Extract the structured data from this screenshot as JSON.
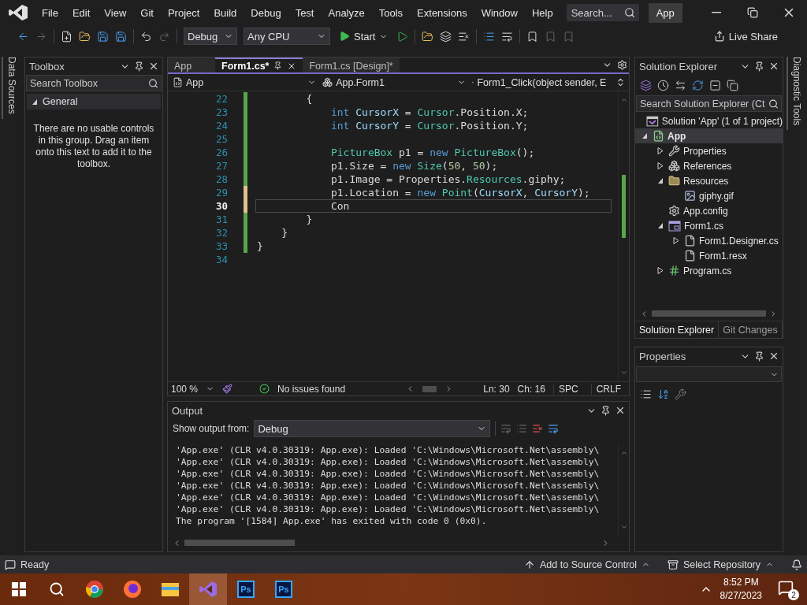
{
  "menu_bar": {
    "items": [
      "File",
      "Edit",
      "View",
      "Git",
      "Project",
      "Build",
      "Debug",
      "Test",
      "Analyze",
      "Tools",
      "Extensions",
      "Window",
      "Help"
    ],
    "search": {
      "placeholder": "Search..."
    },
    "solution_name": "App"
  },
  "toolbar": {
    "configuration": "Debug",
    "platform": "Any CPU",
    "start": "Start",
    "live_share": "Live Share"
  },
  "left_strip": {
    "label": "Data Sources"
  },
  "toolbox": {
    "title": "Toolbox",
    "search": {
      "placeholder": "Search Toolbox"
    },
    "group": {
      "label": "General",
      "expanded": true
    },
    "message": "There are no usable controls in this group. Drag an item onto this text to add it to the toolbox."
  },
  "editor": {
    "tabs": [
      {
        "label": "App",
        "selected": false,
        "pinned": false
      },
      {
        "label": "Form1.cs*",
        "selected": true,
        "pinned": true
      },
      {
        "label": "Form1.cs [Design]*",
        "selected": false,
        "pinned": false
      }
    ],
    "nav": [
      "App",
      "App.Form1",
      "Form1_Click(object sender, E"
    ],
    "lines": [
      {
        "number": "22",
        "changed": true,
        "unsaved": false,
        "current": false,
        "tokens": [
          {
            "kind": "plain",
            "text": "        {"
          }
        ]
      },
      {
        "number": "23",
        "changed": true,
        "unsaved": false,
        "current": false,
        "tokens": [
          {
            "kind": "kw",
            "text": "            int"
          },
          {
            "kind": "var",
            "text": " CursorX"
          },
          {
            "kind": "plain",
            "text": " = "
          },
          {
            "kind": "type",
            "text": "Cursor"
          },
          {
            "kind": "plain",
            "text": ".Position.X;"
          }
        ]
      },
      {
        "number": "24",
        "changed": true,
        "unsaved": false,
        "current": false,
        "tokens": [
          {
            "kind": "kw",
            "text": "            int"
          },
          {
            "kind": "var",
            "text": " CursorY"
          },
          {
            "kind": "plain",
            "text": " = "
          },
          {
            "kind": "type",
            "text": "Cursor"
          },
          {
            "kind": "plain",
            "text": ".Position.Y;"
          }
        ]
      },
      {
        "number": "25",
        "changed": true,
        "unsaved": false,
        "current": false
      },
      {
        "number": "26",
        "changed": true,
        "unsaved": false,
        "current": false,
        "tokens": [
          {
            "kind": "type",
            "text": "            PictureBox"
          },
          {
            "kind": "plain",
            "text": " p1 = "
          },
          {
            "kind": "kw",
            "text": "new"
          },
          {
            "kind": "type",
            "text": " PictureBox"
          },
          {
            "kind": "plain",
            "text": "();"
          }
        ]
      },
      {
        "number": "27",
        "changed": true,
        "unsaved": false,
        "current": false,
        "tokens": [
          {
            "kind": "plain",
            "text": "            p1.Size = "
          },
          {
            "kind": "kw",
            "text": "new"
          },
          {
            "kind": "type",
            "text": " Size"
          },
          {
            "kind": "plain",
            "text": "("
          },
          {
            "kind": "num",
            "text": "50"
          },
          {
            "kind": "plain",
            "text": ", "
          },
          {
            "kind": "num",
            "text": "50"
          },
          {
            "kind": "plain",
            "text": ");"
          }
        ]
      },
      {
        "number": "28",
        "changed": true,
        "unsaved": false,
        "current": false,
        "tokens": [
          {
            "kind": "plain",
            "text": "            p1.Image = Properties."
          },
          {
            "kind": "type",
            "text": "Resources"
          },
          {
            "kind": "plain",
            "text": ".giphy;"
          }
        ]
      },
      {
        "number": "29",
        "changed": true,
        "unsaved": true,
        "current": false,
        "tokens": [
          {
            "kind": "plain",
            "text": "            p1.Location = "
          },
          {
            "kind": "kw",
            "text": "new"
          },
          {
            "kind": "type",
            "text": " Point"
          },
          {
            "kind": "plain",
            "text": "("
          },
          {
            "kind": "var",
            "text": "CursorX"
          },
          {
            "kind": "plain",
            "text": ", "
          },
          {
            "kind": "var",
            "text": "CursorY"
          },
          {
            "kind": "plain",
            "text": ");"
          }
        ]
      },
      {
        "number": "30",
        "changed": true,
        "unsaved": true,
        "current": true,
        "tokens": [
          {
            "kind": "plain",
            "text": "            Con"
          }
        ]
      },
      {
        "number": "31",
        "changed": true,
        "unsaved": false,
        "current": false,
        "tokens": [
          {
            "kind": "plain",
            "text": "        }"
          }
        ]
      },
      {
        "number": "32",
        "changed": true,
        "unsaved": false,
        "current": false,
        "tokens": [
          {
            "kind": "plain",
            "text": "    }"
          }
        ]
      },
      {
        "number": "33",
        "changed": true,
        "unsaved": false,
        "current": false,
        "tokens": [
          {
            "kind": "plain",
            "text": "}"
          }
        ]
      },
      {
        "number": "34",
        "changed": false,
        "current": false
      }
    ],
    "status": {
      "zoom": "100 %",
      "issues": "No issues found",
      "line": "Ln: 30",
      "char": "Ch: 16",
      "whitespace": "SPC",
      "line_ending": "CRLF"
    }
  },
  "output": {
    "title": "Output",
    "source_label": "Show output from:",
    "source": "Debug",
    "lines": [
      "'App.exe' (CLR v4.0.30319: App.exe): Loaded 'C:\\Windows\\Microsoft.Net\\assembly\\",
      "'App.exe' (CLR v4.0.30319: App.exe): Loaded 'C:\\Windows\\Microsoft.Net\\assembly\\",
      "'App.exe' (CLR v4.0.30319: App.exe): Loaded 'C:\\Windows\\Microsoft.Net\\assembly\\",
      "'App.exe' (CLR v4.0.30319: App.exe): Loaded 'C:\\Windows\\Microsoft.Net\\assembly\\",
      "'App.exe' (CLR v4.0.30319: App.exe): Loaded 'C:\\Windows\\Microsoft.Net\\assembly\\",
      "'App.exe' (CLR v4.0.30319: App.exe): Loaded 'C:\\Windows\\Microsoft.Net\\assembly\\",
      "The program '[1584] App.exe' has exited with code 0 (0x0)."
    ]
  },
  "solution_explorer": {
    "title": "Solution Explorer",
    "search": {
      "placeholder": "Search Solution Explorer (Ct"
    },
    "tree": [
      {
        "label": "Solution 'App' (1 of 1 project)",
        "kind": "solution",
        "selected": false,
        "children": [
          {
            "label": "App",
            "kind": "project",
            "selected": true,
            "expanded": true,
            "children": [
              {
                "label": "Properties",
                "kind": "properties",
                "selected": false,
                "expanded": false
              },
              {
                "label": "References",
                "kind": "references",
                "selected": false,
                "expanded": false
              },
              {
                "label": "Resources",
                "kind": "folder",
                "selected": false,
                "expanded": true,
                "children": [
                  {
                    "label": "giphy.gif",
                    "kind": "image",
                    "selected": false
                  }
                ]
              },
              {
                "label": "App.config",
                "kind": "config",
                "selected": false
              },
              {
                "label": "Form1.cs",
                "kind": "form",
                "selected": false,
                "expanded": true,
                "children": [
                  {
                    "label": "Form1.Designer.cs",
                    "kind": "file",
                    "selected": false,
                    "expanded": false
                  },
                  {
                    "label": "Form1.resx",
                    "kind": "file",
                    "selected": false
                  }
                ]
              },
              {
                "label": "Program.cs",
                "kind": "csharp",
                "selected": false,
                "expanded": false
              }
            ]
          }
        ]
      }
    ],
    "tabs": [
      {
        "label": "Solution Explorer",
        "selected": true
      },
      {
        "label": "Git Changes",
        "selected": false
      }
    ]
  },
  "properties": {
    "title": "Properties"
  },
  "right_strip": {
    "label": "Diagnostic Tools"
  },
  "status_bar": {
    "state": "Ready",
    "source_control": "Add to Source Control",
    "repository": "Select Repository"
  },
  "taskbar": {
    "apps": [
      {
        "kind": "chrome",
        "selected": false
      },
      {
        "kind": "firefox",
        "selected": false
      },
      {
        "kind": "explorer",
        "selected": false
      },
      {
        "kind": "vs",
        "selected": true
      },
      {
        "kind": "ps",
        "label": "Ps",
        "selected": false
      },
      {
        "kind": "ps",
        "label": "Ps",
        "selected": false
      }
    ],
    "time": "8:52 PM",
    "date": "8/27/2023",
    "notifications": "2"
  }
}
